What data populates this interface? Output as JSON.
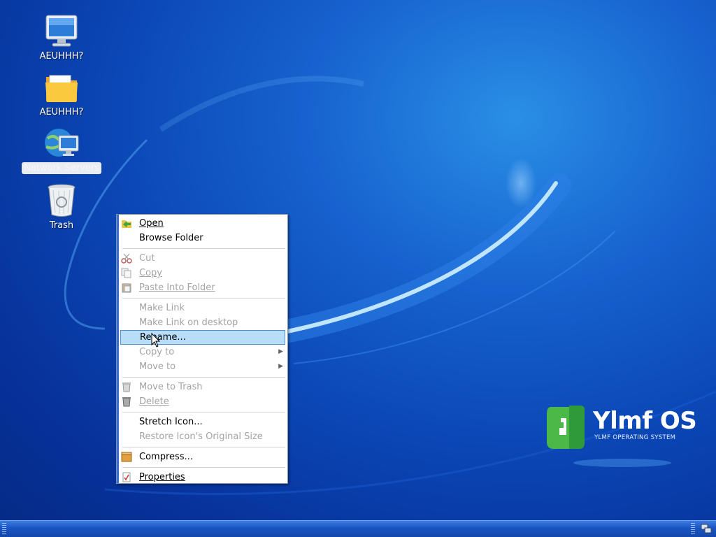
{
  "desktop": {
    "icons": [
      {
        "label": "AEUHHH?",
        "icon": "monitor-icon"
      },
      {
        "label": "AEUHHH?",
        "icon": "folder-icon"
      },
      {
        "label": "Network Servers",
        "icon": "network-servers-icon",
        "selected": true
      },
      {
        "label": "Trash",
        "icon": "trash-icon"
      }
    ]
  },
  "context_menu": {
    "open": "Open",
    "browse_folder": "Browse Folder",
    "cut": "Cut",
    "copy": "Copy",
    "paste_into_folder": "Paste Into Folder",
    "make_link": "Make Link",
    "make_link_desktop": "Make Link on desktop",
    "rename": "Rename...",
    "copy_to": "Copy to",
    "move_to": "Move to",
    "move_to_trash": "Move to Trash",
    "delete": "Delete",
    "stretch_icon": "Stretch Icon...",
    "restore_icon_size": "Restore Icon's Original Size",
    "compress": "Compress...",
    "properties": "Properties",
    "highlighted_item": "Rename..."
  },
  "branding": {
    "title": "Ylmf OS",
    "subtitle": "YLMF OPERATING SYSTEM",
    "accent": "#3aa83a"
  },
  "colors": {
    "desktop": "#0b47b6",
    "menu_highlight": "#b8ddf8",
    "taskbar": "#1a54c2"
  }
}
